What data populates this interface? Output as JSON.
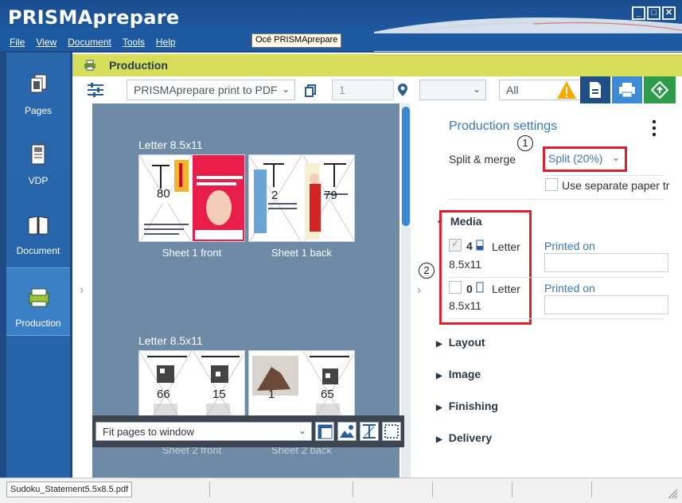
{
  "window": {
    "title": "PRISMAprepare"
  },
  "menu": [
    "File",
    "View",
    "Document",
    "Tools",
    "Help"
  ],
  "tooltip": "Océ PRISMAprepare",
  "nav": [
    {
      "label": "Pages"
    },
    {
      "label": "VDP"
    },
    {
      "label": "Document"
    },
    {
      "label": "Production"
    }
  ],
  "production_bar": {
    "title": "Production"
  },
  "toolbar": {
    "printer_select": "PRISMAprepare print to PDF",
    "copies": "1",
    "location_select": "",
    "pages_select": "All"
  },
  "preview": {
    "sheets": [
      {
        "title": "Letter 8.5x11",
        "front_label": "Sheet 1 front",
        "back_label": "Sheet 1 back",
        "front_pages": [
          "80",
          ""
        ],
        "back_pages": [
          "2",
          "79"
        ]
      },
      {
        "title": "Letter 8.5x11",
        "front_label": "Sheet 2 front",
        "back_label": "Sheet 2 back",
        "front_pages": [
          "66",
          "15"
        ],
        "back_pages": [
          "1",
          "65"
        ]
      }
    ],
    "fit_select": "Fit pages to window"
  },
  "settings": {
    "title": "Production settings",
    "split_merge_label": "Split & merge",
    "split_value": "Split (20%)",
    "separate_paper_label": "Use separate paper tr",
    "media": {
      "label": "Media",
      "items": [
        {
          "count": "4",
          "name": "Letter",
          "size": "8.5x11",
          "printed_on": "Printed on"
        },
        {
          "count": "0",
          "name": "Letter",
          "size": "8.5x11",
          "printed_on": "Printed on"
        }
      ]
    },
    "sections": [
      "Layout",
      "Image",
      "Finishing",
      "Delivery"
    ],
    "callouts": [
      "1",
      "2"
    ]
  },
  "status": {
    "file": "Sudoku_Statement5.5x8.5.pdf"
  },
  "colors": {
    "accent": "#3f76b5",
    "highlight": "#e2202a",
    "prodbar": "#d6dd5a",
    "nav": "#2562a8"
  }
}
